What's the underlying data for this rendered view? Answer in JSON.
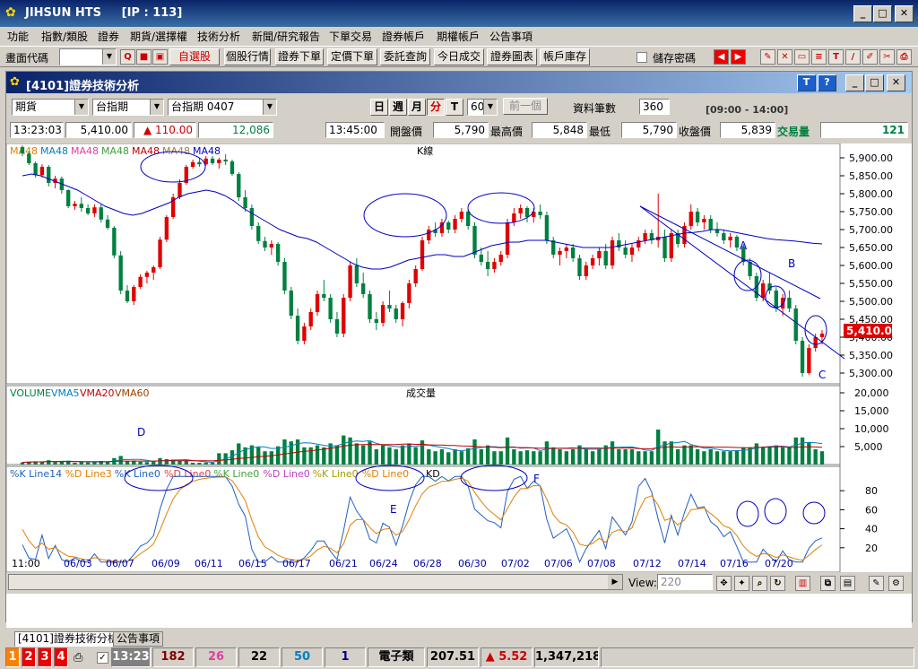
{
  "app": {
    "title": "JIHSUN HTS",
    "ip": "[IP : 113]"
  },
  "menu": [
    "功能",
    "指數/類股",
    "證券",
    "期貨/選擇權",
    "技術分析",
    "新聞/研究報告",
    "下單交易",
    "證券帳戶",
    "期權帳戶",
    "公告事項"
  ],
  "toolbar": {
    "code_label": "畫面代碼",
    "buttons": [
      "自選股",
      "個股行情",
      "證券下單",
      "定價下單",
      "委託查詢",
      "今日成交",
      "證券圖表",
      "帳戶庫存"
    ],
    "save_password": "儲存密碼"
  },
  "window": {
    "title": "[4101]證券技術分析"
  },
  "controls": {
    "market": "期貨",
    "index": "台指期",
    "contract": "台指期 0407",
    "periods": [
      "日",
      "週",
      "月",
      "分",
      "T"
    ],
    "interval": "60",
    "prev_button": "前一個",
    "records_label": "資料筆數",
    "records_value": "360",
    "session": "[09:00 - 14:00]"
  },
  "quote": {
    "time": "13:23:03",
    "price": "5,410.00",
    "change": "110.00",
    "volume": "12,086",
    "bar_time": "13:45:00",
    "open_label": "開盤價",
    "open": "5,790",
    "high_label": "最高價",
    "high": "5,848",
    "low_label": "最低",
    "low": "5,790",
    "close_label": "收盤價",
    "close": "5,839",
    "trade_vol_label": "交易量",
    "trade_vol": "121"
  },
  "chart_data": [
    {
      "type": "candlestick",
      "title": "K線",
      "legend": [
        "MA48",
        "MA48",
        "MA48",
        "MA48",
        "MA48",
        "MA48",
        "MA48"
      ],
      "yticks": [
        "5,900.00",
        "5,850.00",
        "5,800.00",
        "5,750.00",
        "5,700.00",
        "5,650.00",
        "5,600.00",
        "5,550.00",
        "5,500.00",
        "5,450.00",
        "5,400.00",
        "5,350.00",
        "5,300.00"
      ],
      "yvals": [
        5900,
        5850,
        5800,
        5750,
        5700,
        5650,
        5600,
        5550,
        5500,
        5450,
        5400,
        5350,
        5300
      ],
      "ylim": [
        5270,
        5940
      ],
      "last_price": "5,410.00",
      "annotations": [
        "A",
        "B",
        "C"
      ],
      "candles": [
        [
          5930,
          5935,
          5905,
          5912
        ],
        [
          5912,
          5918,
          5880,
          5885
        ],
        [
          5885,
          5890,
          5845,
          5852
        ],
        [
          5852,
          5882,
          5845,
          5875
        ],
        [
          5875,
          5880,
          5820,
          5830
        ],
        [
          5830,
          5850,
          5815,
          5842
        ],
        [
          5842,
          5848,
          5800,
          5810
        ],
        [
          5810,
          5812,
          5760,
          5765
        ],
        [
          5765,
          5780,
          5755,
          5772
        ],
        [
          5772,
          5790,
          5750,
          5760
        ],
        [
          5760,
          5770,
          5740,
          5745
        ],
        [
          5745,
          5770,
          5735,
          5762
        ],
        [
          5762,
          5770,
          5720,
          5728
        ],
        [
          5728,
          5740,
          5700,
          5705
        ],
        [
          5705,
          5710,
          5620,
          5628
        ],
        [
          5628,
          5640,
          5520,
          5530
        ],
        [
          5530,
          5545,
          5495,
          5500
        ],
        [
          5500,
          5545,
          5490,
          5540
        ],
        [
          5540,
          5575,
          5535,
          5568
        ],
        [
          5568,
          5585,
          5550,
          5580
        ],
        [
          5580,
          5600,
          5560,
          5595
        ],
        [
          5595,
          5680,
          5590,
          5672
        ],
        [
          5672,
          5740,
          5665,
          5735
        ],
        [
          5735,
          5800,
          5730,
          5790
        ],
        [
          5790,
          5840,
          5785,
          5830
        ],
        [
          5830,
          5880,
          5825,
          5875
        ],
        [
          5875,
          5895,
          5870,
          5888
        ],
        [
          5888,
          5900,
          5875,
          5882
        ],
        [
          5882,
          5905,
          5878,
          5898
        ],
        [
          5898,
          5905,
          5880,
          5885
        ],
        [
          5885,
          5900,
          5870,
          5895
        ],
        [
          5895,
          5910,
          5880,
          5890
        ],
        [
          5890,
          5895,
          5850,
          5855
        ],
        [
          5855,
          5860,
          5780,
          5790
        ],
        [
          5790,
          5810,
          5750,
          5760
        ],
        [
          5760,
          5770,
          5700,
          5710
        ],
        [
          5710,
          5720,
          5660,
          5668
        ],
        [
          5668,
          5680,
          5640,
          5650
        ],
        [
          5650,
          5670,
          5630,
          5660
        ],
        [
          5660,
          5665,
          5600,
          5610
        ],
        [
          5610,
          5620,
          5520,
          5530
        ],
        [
          5530,
          5540,
          5450,
          5460
        ],
        [
          5460,
          5480,
          5380,
          5390
        ],
        [
          5390,
          5440,
          5380,
          5430
        ],
        [
          5430,
          5480,
          5420,
          5470
        ],
        [
          5470,
          5530,
          5460,
          5520
        ],
        [
          5520,
          5560,
          5500,
          5510
        ],
        [
          5510,
          5520,
          5440,
          5450
        ],
        [
          5450,
          5470,
          5400,
          5410
        ],
        [
          5410,
          5520,
          5400,
          5510
        ],
        [
          5510,
          5610,
          5500,
          5600
        ],
        [
          5600,
          5620,
          5540,
          5550
        ],
        [
          5550,
          5580,
          5510,
          5520
        ],
        [
          5520,
          5530,
          5440,
          5450
        ],
        [
          5450,
          5470,
          5420,
          5440
        ],
        [
          5440,
          5500,
          5430,
          5490
        ],
        [
          5490,
          5530,
          5470,
          5480
        ],
        [
          5480,
          5490,
          5440,
          5450
        ],
        [
          5450,
          5500,
          5430,
          5495
        ],
        [
          5495,
          5560,
          5480,
          5550
        ],
        [
          5550,
          5600,
          5540,
          5590
        ],
        [
          5590,
          5680,
          5585,
          5670
        ],
        [
          5670,
          5710,
          5660,
          5700
        ],
        [
          5700,
          5720,
          5680,
          5690
        ],
        [
          5690,
          5730,
          5680,
          5720
        ],
        [
          5720,
          5725,
          5690,
          5700
        ],
        [
          5700,
          5740,
          5690,
          5730
        ],
        [
          5730,
          5760,
          5720,
          5750
        ],
        [
          5750,
          5755,
          5700,
          5710
        ],
        [
          5710,
          5720,
          5620,
          5630
        ],
        [
          5630,
          5650,
          5600,
          5610
        ],
        [
          5610,
          5640,
          5570,
          5590
        ],
        [
          5590,
          5620,
          5580,
          5610
        ],
        [
          5610,
          5640,
          5600,
          5630
        ],
        [
          5630,
          5730,
          5620,
          5720
        ],
        [
          5720,
          5760,
          5710,
          5745
        ],
        [
          5745,
          5770,
          5730,
          5760
        ],
        [
          5760,
          5765,
          5720,
          5735
        ],
        [
          5735,
          5760,
          5720,
          5750
        ],
        [
          5750,
          5770,
          5730,
          5740
        ],
        [
          5740,
          5750,
          5660,
          5670
        ],
        [
          5670,
          5680,
          5620,
          5630
        ],
        [
          5630,
          5650,
          5600,
          5640
        ],
        [
          5640,
          5660,
          5620,
          5650
        ],
        [
          5650,
          5660,
          5610,
          5620
        ],
        [
          5620,
          5630,
          5560,
          5570
        ],
        [
          5570,
          5610,
          5560,
          5600
        ],
        [
          5600,
          5630,
          5590,
          5620
        ],
        [
          5620,
          5650,
          5600,
          5640
        ],
        [
          5640,
          5660,
          5590,
          5600
        ],
        [
          5600,
          5680,
          5590,
          5670
        ],
        [
          5670,
          5690,
          5640,
          5650
        ],
        [
          5650,
          5670,
          5620,
          5630
        ],
        [
          5630,
          5660,
          5610,
          5650
        ],
        [
          5650,
          5680,
          5640,
          5670
        ],
        [
          5670,
          5700,
          5660,
          5690
        ],
        [
          5690,
          5700,
          5660,
          5670
        ],
        [
          5670,
          5800,
          5650,
          5680
        ],
        [
          5680,
          5700,
          5610,
          5620
        ],
        [
          5620,
          5700,
          5610,
          5690
        ],
        [
          5690,
          5700,
          5650,
          5660
        ],
        [
          5660,
          5720,
          5650,
          5710
        ],
        [
          5710,
          5770,
          5700,
          5750
        ],
        [
          5750,
          5760,
          5710,
          5720
        ],
        [
          5720,
          5740,
          5700,
          5730
        ],
        [
          5730,
          5740,
          5690,
          5700
        ],
        [
          5700,
          5720,
          5680,
          5690
        ],
        [
          5690,
          5700,
          5660,
          5670
        ],
        [
          5670,
          5690,
          5650,
          5680
        ],
        [
          5680,
          5685,
          5640,
          5650
        ],
        [
          5650,
          5660,
          5600,
          5610
        ],
        [
          5610,
          5620,
          5560,
          5570
        ],
        [
          5570,
          5580,
          5500,
          5510
        ],
        [
          5510,
          5560,
          5500,
          5550
        ],
        [
          5550,
          5580,
          5520,
          5530
        ],
        [
          5530,
          5540,
          5470,
          5480
        ],
        [
          5480,
          5520,
          5460,
          5510
        ],
        [
          5510,
          5530,
          5470,
          5480
        ],
        [
          5480,
          5490,
          5380,
          5390
        ],
        [
          5390,
          5400,
          5290,
          5300
        ],
        [
          5300,
          5380,
          5295,
          5370
        ],
        [
          5370,
          5410,
          5360,
          5400
        ],
        [
          5400,
          5420,
          5380,
          5410
        ]
      ],
      "ma": [
        5850,
        5855,
        5850,
        5840,
        5830,
        5820,
        5810,
        5795,
        5780,
        5765,
        5755,
        5745,
        5740,
        5745,
        5755,
        5765,
        5775,
        5790,
        5800,
        5805,
        5810,
        5805,
        5795,
        5780,
        5760,
        5745,
        5730,
        5715,
        5700,
        5690,
        5680,
        5675,
        5665,
        5650,
        5635,
        5620,
        5605,
        5595,
        5590,
        5590,
        5595,
        5605,
        5615,
        5620,
        5625,
        5630,
        5630,
        5625,
        5625,
        5635,
        5645,
        5655,
        5660,
        5665,
        5665,
        5670,
        5670,
        5670,
        5665,
        5660,
        5655,
        5650,
        5650,
        5650,
        5650,
        5655,
        5660,
        5665,
        5670,
        5675,
        5680,
        5685,
        5690,
        5692,
        5695,
        5700,
        5700,
        5695,
        5690,
        5685,
        5680,
        5675,
        5672,
        5670,
        5668,
        5665,
        5662,
        5660
      ]
    },
    {
      "type": "bar",
      "title": "成交量",
      "legend": [
        "VOLUME",
        "VMA5",
        "VMA20",
        "VMA60"
      ],
      "yticks": [
        "20,000",
        "15,000",
        "10,000",
        "5,000"
      ],
      "yvals": [
        20000,
        15000,
        10000,
        5000
      ],
      "ylim": [
        0,
        22000
      ],
      "annotations": [
        "D"
      ]
    },
    {
      "type": "line",
      "title": "KD",
      "legend": [
        "%K Line14",
        "%D Line3",
        "%K Line0",
        "%D Line0",
        "%K Line0",
        "%D Line0",
        "%K Line0",
        "%D Line0"
      ],
      "yticks": [
        "80",
        "60",
        "40",
        "20"
      ],
      "yvals": [
        80,
        60,
        40,
        20
      ],
      "ylim": [
        0,
        100
      ],
      "annotations": [
        "E",
        "F"
      ],
      "xlabels": [
        "11:00",
        "06/03",
        "06/07",
        "06/09",
        "06/11",
        "06/15",
        "06/17",
        "06/21",
        "06/24",
        "06/28",
        "06/30",
        "07/02",
        "07/06",
        "07/08",
        "07/12",
        "07/14",
        "07/16",
        "07/20"
      ]
    }
  ],
  "footer": {
    "view_label": "View:",
    "view_value": "220",
    "tabs": [
      "[4101]證券技術分析",
      "公告事項"
    ],
    "nums": [
      "1",
      "2",
      "3",
      "4"
    ],
    "time": "13:23",
    "s1": "182",
    "s2": "26",
    "s3": "22",
    "s4": "50",
    "s5": "1",
    "sector": "電子類",
    "sector_val": "207.51",
    "sector_chg": "5.52",
    "sector_vol": "1,347,218"
  },
  "colors": {
    "up": "#e00000",
    "down": "#008040",
    "ma": "#0000c0",
    "title_bg": "#0a246a",
    "price_box": "#e00000"
  }
}
